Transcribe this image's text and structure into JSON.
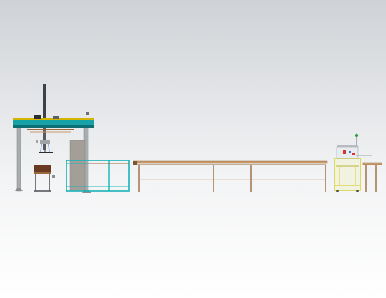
{
  "scene": {
    "background_top": "#cfd2d6",
    "background_bottom": "#ffffff",
    "colors": {
      "gantry_beam": "#17a2a8",
      "gantry_beam_dark": "#0d6f74",
      "beam_trim": "#d4b400",
      "column": "#a9adb0",
      "column_dark": "#7d8184",
      "cabinet": "#a39e98",
      "teal_frame": "#18b3b8",
      "conveyor": "#9a6a3c",
      "conveyor_light": "#c89a6a",
      "machine_body": "#d8d33a",
      "machine_panel": "#e9ecef",
      "accent_red": "#d8332a",
      "accent_green": "#2ea043",
      "accent_blue": "#3a6fd8",
      "table_top": "#6b3a22"
    },
    "components": [
      {
        "id": "gantry-robot",
        "icon": "gantry-crane-icon"
      },
      {
        "id": "control-cabinet",
        "icon": "cabinet-icon"
      },
      {
        "id": "teal-infeed-frame",
        "icon": "frame-icon"
      },
      {
        "id": "long-roller-conveyor",
        "icon": "conveyor-icon"
      },
      {
        "id": "inspection-machine",
        "icon": "machine-icon"
      },
      {
        "id": "outfeed-conveyor",
        "icon": "conveyor-icon"
      }
    ]
  }
}
